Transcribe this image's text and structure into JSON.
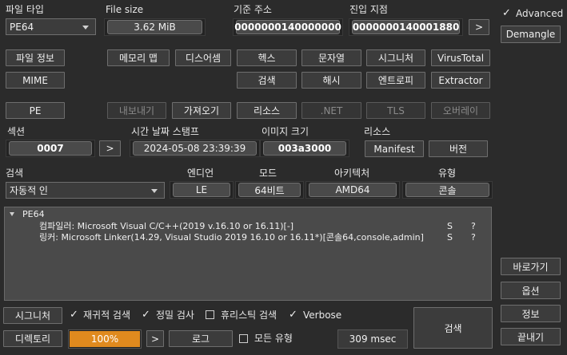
{
  "file_type": {
    "label": "파일 타입",
    "value": "PE64"
  },
  "file_size": {
    "label": "File size",
    "value": "3.62 MiB"
  },
  "base_address": {
    "label": "기준 주소",
    "value": "0000000140000000"
  },
  "entry_point": {
    "label": "진입 지점",
    "value": "0000000140001880",
    "nav": ">"
  },
  "advanced": {
    "label": "Advanced",
    "checked": true
  },
  "demangle_label": "Demangle",
  "row1": {
    "file_info": "파일 정보",
    "memory_map": "메모리 맵",
    "disasm": "디스어셈",
    "hex": "헥스",
    "strings": "문자열",
    "signatures": "시그니처",
    "virustotal": "VirusTotal"
  },
  "row2": {
    "mime": "MIME",
    "search": "검색",
    "hash": "해시",
    "entropy": "엔트로피",
    "extractor": "Extractor"
  },
  "row3": {
    "pe": "PE",
    "export": "내보내기",
    "import": "가져오기",
    "resources": "리소스",
    "net": ".NET",
    "tls": "TLS",
    "overlay": "오버레이"
  },
  "sections": {
    "label": "섹션",
    "value": "0007",
    "nav": ">"
  },
  "timestamp": {
    "label": "시간 날짜 스탬프",
    "value": "2024-05-08 23:39:39"
  },
  "image_size": {
    "label": "이미지 크기",
    "value": "003a3000"
  },
  "resources": {
    "label": "리소스",
    "manifest": "Manifest",
    "version": "버전"
  },
  "scan": {
    "label": "검색",
    "value": "자동적 인"
  },
  "endian": {
    "label": "엔디언",
    "value": "LE"
  },
  "mode": {
    "label": "모드",
    "value": "64비트"
  },
  "arch": {
    "label": "아키텍처",
    "value": "AMD64"
  },
  "type": {
    "label": "유형",
    "value": "콘솔"
  },
  "results": {
    "root": "PE64",
    "entries": [
      {
        "text": "컴파일러: Microsoft Visual C/C++(2019 v.16.10 or 16.11)[-]",
        "s": "S",
        "q": "?"
      },
      {
        "text": "링커: Microsoft Linker(14.29, Visual Studio 2019 16.10 or 16.11*)[콘솔64,console,admin]",
        "s": "S",
        "q": "?"
      }
    ]
  },
  "side": {
    "shortcuts": "바로가기",
    "options": "옵션",
    "about": "정보",
    "exit": "끝내기"
  },
  "bottom": {
    "signatures": "시그니처",
    "recursive": {
      "label": "재귀적 검색",
      "checked": true
    },
    "deep": {
      "label": "정밀 검사",
      "checked": true
    },
    "heuristic": {
      "label": "휴리스틱 검색",
      "checked": false
    },
    "verbose": {
      "label": "Verbose",
      "checked": true
    },
    "directory": "디렉토리",
    "progress": {
      "label": "100%",
      "value": 100,
      "color": "#e08a1e"
    },
    "nav": ">",
    "log": "로그",
    "all_types": {
      "label": "모든 유형",
      "checked": false
    },
    "time": "309 msec",
    "scan_button": "검색"
  }
}
